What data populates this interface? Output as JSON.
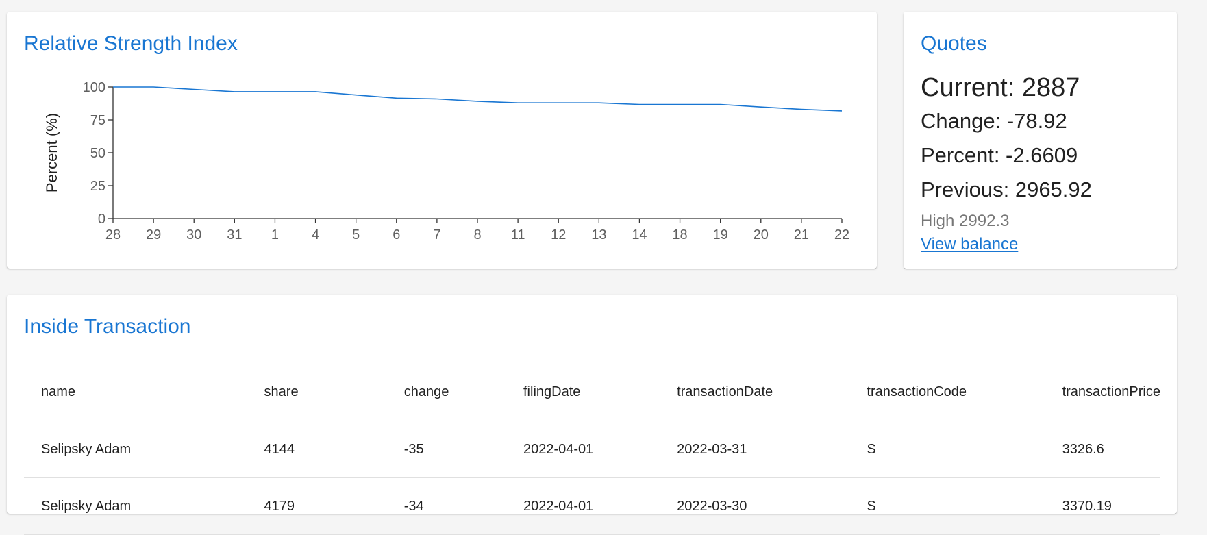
{
  "rsi": {
    "title": "Relative Strength Index"
  },
  "chart_data": {
    "type": "line",
    "title": "Relative Strength Index",
    "xlabel": "",
    "ylabel": "Percent (%)",
    "ylim": [
      0,
      100
    ],
    "yticks": [
      0,
      25,
      50,
      75,
      100
    ],
    "categories": [
      "28",
      "29",
      "30",
      "31",
      "1",
      "4",
      "5",
      "6",
      "7",
      "8",
      "11",
      "12",
      "13",
      "14",
      "18",
      "19",
      "20",
      "21",
      "22"
    ],
    "values": [
      100,
      100,
      98.2,
      96.4,
      96.4,
      96.4,
      93.9,
      91.5,
      90.9,
      89.1,
      87.9,
      87.9,
      87.9,
      86.7,
      86.7,
      86.7,
      84.8,
      83.0,
      81.8
    ],
    "grid": false,
    "color": "#1976d2"
  },
  "quotes": {
    "title": "Quotes",
    "current": "Current: 2887",
    "change": "Change: -78.92",
    "percent": "Percent: -2.6609",
    "previous": "Previous: 2965.92",
    "high": "High 2992.3",
    "link": "View balance"
  },
  "transactions": {
    "title": "Inside Transaction",
    "headers": [
      "name",
      "share",
      "change",
      "filingDate",
      "transactionDate",
      "transactionCode",
      "transactionPrice"
    ],
    "rows": [
      [
        "Selipsky Adam",
        "4144",
        "-35",
        "2022-04-01",
        "2022-03-31",
        "S",
        "3326.6"
      ],
      [
        "Selipsky Adam",
        "4179",
        "-34",
        "2022-04-01",
        "2022-03-30",
        "S",
        "3370.19"
      ]
    ]
  }
}
